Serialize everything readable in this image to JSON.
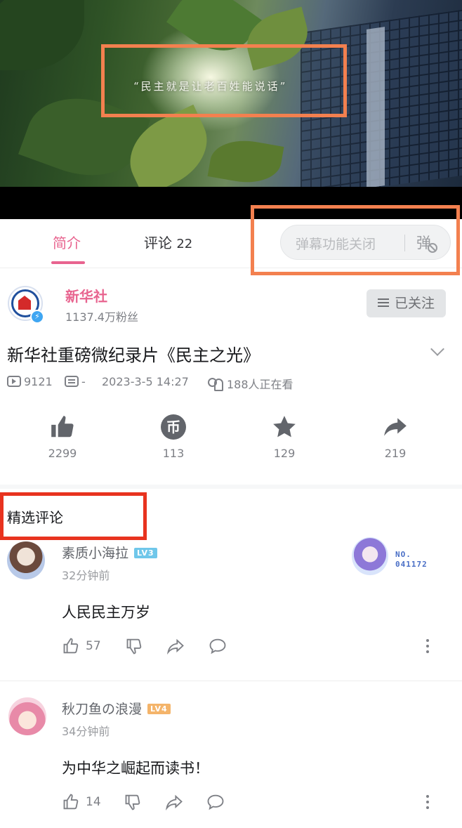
{
  "video": {
    "quote": "“民主就是让老百姓能说话”"
  },
  "tabs": [
    {
      "label": "简介",
      "active": true
    },
    {
      "label": "评论",
      "count": "22",
      "active": false
    }
  ],
  "danmaku": {
    "label": "弹幕功能关闭",
    "icon_glyph": "弹"
  },
  "uploader": {
    "name": "新华社",
    "fans": "1137.4万粉丝",
    "follow_label": "已关注"
  },
  "video_info": {
    "title": "新华社重磅微纪录片《民主之光》",
    "plays": "9121",
    "danmaku_count": "-",
    "date": "2023-3-5 14:27",
    "watching": "188人正在看"
  },
  "actions": [
    {
      "name": "like",
      "count": "2299"
    },
    {
      "name": "coin",
      "count": "113",
      "glyph": "币"
    },
    {
      "name": "favorite",
      "count": "129"
    },
    {
      "name": "share",
      "count": "219"
    }
  ],
  "section_title": "精选评论",
  "comments": [
    {
      "user": "素质小海拉",
      "level": "LV3",
      "level_color": "#6fc7ea",
      "time": "32分钟前",
      "text": "人民民主万岁",
      "likes": "57",
      "fan_badge": "NO.\n041172"
    },
    {
      "user": "秋刀鱼の浪漫",
      "level": "LV4",
      "level_color": "#f4b46a",
      "time": "34分钟前",
      "text": "为中华之崛起而读书！",
      "likes": "14"
    }
  ],
  "colors": {
    "accent_pink": "#e8648f",
    "highlight_orange": "#f3804f",
    "highlight_red": "#e8331f"
  }
}
